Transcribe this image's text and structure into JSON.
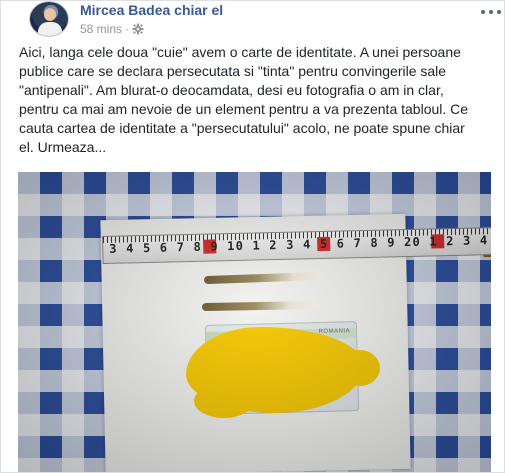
{
  "post": {
    "author_name": "Mircea Badea chiar el",
    "timestamp": "58 mins",
    "separator": "·",
    "audience_icon": "gear-icon",
    "more_icon": "more-options-icon",
    "text": "Aici, langa cele doua \"cuie\" avem o carte de identitate. A unei persoane\npublice care se declara persecutata si \"tinta\" pentru convingerile sale\n\"antipenali\". Am blurat-o deocamdata, desi eu fotografia o am in clar,\npentru ca mai am nevoie de un element pentru a va prezenta tabloul. Ce\ncauta cartea de identitate a \"persecutatului\" acolo, ne poate spune chiar\nel. Urmeaza..."
  },
  "photo": {
    "ruler_numbers": "3 4 5 6 7 8 9 10 1 2 3 4 5 6 7 8 9 20 1 2 3 4 5 6 7 8 9 30 1 2 3",
    "card_country_text": "ROMANIA",
    "blur_color": "#f6c800",
    "tablecloth_color": "#2c4fa0"
  },
  "colors": {
    "author_link": "#385898",
    "meta_gray": "#90949c",
    "body_text": "#1d2129"
  }
}
